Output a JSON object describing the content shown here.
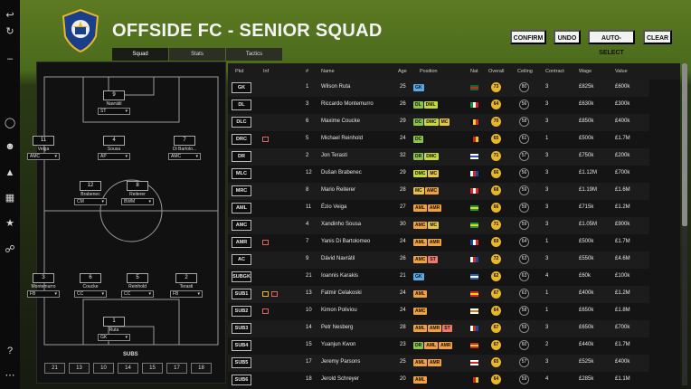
{
  "header": {
    "title": "OFFSIDE FC - SENIOR SQUAD",
    "buttons": [
      "CONFIRM",
      "UNDO",
      "AUTO-SELECT",
      "CLEAR"
    ]
  },
  "tabs": [
    "Squad",
    "Stats",
    "Tactics"
  ],
  "rail_icons": [
    "back-icon",
    "refresh-icon",
    "shield-icon",
    "users-icon",
    "tactics-icon",
    "calendar-icon",
    "trophy-icon",
    "cart-icon",
    "help-icon",
    "more-icon"
  ],
  "pitch": {
    "players": [
      {
        "num": "9",
        "name": "Navrátil",
        "role": "ST"
      },
      {
        "num": "11",
        "name": "Veiga",
        "role": "AMC"
      },
      {
        "num": "4",
        "name": "Sousa",
        "role": "AP"
      },
      {
        "num": "7",
        "name": "Di Bartolo...",
        "role": "AMC"
      },
      {
        "num": "12",
        "name": "Brabenec",
        "role": "CM"
      },
      {
        "num": "8",
        "name": "Reiterer",
        "role": "BWM"
      },
      {
        "num": "3",
        "name": "Montemurro",
        "role": "FB"
      },
      {
        "num": "6",
        "name": "Coucke",
        "role": "CC"
      },
      {
        "num": "5",
        "name": "Reinhold",
        "role": "CC"
      },
      {
        "num": "2",
        "name": "Terasti",
        "role": "FB"
      },
      {
        "num": "1",
        "name": "Ruta",
        "role": "GK"
      }
    ],
    "subs_label": "SUBS",
    "subs": [
      "21",
      "13",
      "10",
      "14",
      "15",
      "17",
      "18"
    ]
  },
  "table": {
    "headers": [
      "Pkd",
      "Inf",
      "#",
      "Name",
      "Age",
      "Position",
      "Nat",
      "Overall",
      "Ceiling",
      "Contract",
      "Wage",
      "Value"
    ],
    "rows": [
      {
        "pkd": "GK",
        "inf": "",
        "num": "1",
        "name": "Wilson Ruta",
        "age": "25",
        "pos": [
          [
            "GK",
            "gk"
          ]
        ],
        "nat": "pt",
        "ovr": "73",
        "ceil": "80",
        "contract": "3",
        "wage": "£825k",
        "value": "£600k"
      },
      {
        "pkd": "DL",
        "inf": "",
        "num": "3",
        "name": "Riccardo Montemurro",
        "age": "26",
        "pos": [
          [
            "DL",
            "def"
          ],
          [
            "DML",
            "dm"
          ]
        ],
        "nat": "it",
        "ovr": "64",
        "ceil": "56",
        "contract": "3",
        "wage": "£630k",
        "value": "£300k"
      },
      {
        "pkd": "DLC",
        "inf": "",
        "num": "6",
        "name": "Maxime Coucke",
        "age": "29",
        "pos": [
          [
            "DC",
            "def"
          ],
          [
            "DMC",
            "dm"
          ],
          [
            "MC",
            "mc"
          ]
        ],
        "nat": "be",
        "ovr": "70",
        "ceil": "58",
        "contract": "3",
        "wage": "£850k",
        "value": "£400k"
      },
      {
        "pkd": "DRC",
        "inf": "card",
        "num": "5",
        "name": "Michael Reinhold",
        "age": "24",
        "pos": [
          [
            "DC",
            "def"
          ]
        ],
        "nat": "de",
        "ovr": "65",
        "ceil": "61",
        "contract": "1",
        "wage": "£500k",
        "value": "£1.7M"
      },
      {
        "pkd": "DR",
        "inf": "",
        "num": "2",
        "name": "Jon Terasti",
        "age": "32",
        "pos": [
          [
            "DR",
            "def"
          ],
          [
            "DMC",
            "dm"
          ]
        ],
        "nat": "fi",
        "ovr": "71",
        "ceil": "57",
        "contract": "3",
        "wage": "£750k",
        "value": "£200k"
      },
      {
        "pkd": "MLC",
        "inf": "",
        "num": "12",
        "name": "Dušan Brabenec",
        "age": "29",
        "pos": [
          [
            "DMC",
            "dm"
          ],
          [
            "MC",
            "mc"
          ]
        ],
        "nat": "cz",
        "ovr": "66",
        "ceil": "56",
        "contract": "3",
        "wage": "£1.12M",
        "value": "£700k"
      },
      {
        "pkd": "MRC",
        "inf": "",
        "num": "8",
        "name": "Mario Reiterer",
        "age": "28",
        "pos": [
          [
            "MC",
            "mc"
          ],
          [
            "AMC",
            "am"
          ]
        ],
        "nat": "at",
        "ovr": "68",
        "ceil": "59",
        "contract": "3",
        "wage": "£1.19M",
        "value": "£1.6M"
      },
      {
        "pkd": "AML",
        "inf": "",
        "num": "11",
        "name": "Ézio Veiga",
        "age": "27",
        "pos": [
          [
            "AML",
            "am"
          ],
          [
            "AMR",
            "am"
          ]
        ],
        "nat": "br",
        "ovr": "66",
        "ceil": "59",
        "contract": "3",
        "wage": "£715k",
        "value": "£1.2M"
      },
      {
        "pkd": "AMC",
        "inf": "",
        "num": "4",
        "name": "Xandinho Sousa",
        "age": "30",
        "pos": [
          [
            "AMC",
            "am"
          ],
          [
            "MC",
            "mc"
          ]
        ],
        "nat": "br",
        "ovr": "71",
        "ceil": "59",
        "contract": "3",
        "wage": "£1.05M",
        "value": "£900k"
      },
      {
        "pkd": "AMR",
        "inf": "card",
        "num": "7",
        "name": "Yanis Di Bartolomeo",
        "age": "24",
        "pos": [
          [
            "AML",
            "am"
          ],
          [
            "AMR",
            "am"
          ]
        ],
        "nat": "fr",
        "ovr": "69",
        "ceil": "64",
        "contract": "1",
        "wage": "£500k",
        "value": "£1.7M"
      },
      {
        "pkd": "AC",
        "inf": "",
        "num": "9",
        "name": "Dávid Navrátil",
        "age": "26",
        "pos": [
          [
            "AMC",
            "am"
          ],
          [
            "ST",
            "st"
          ]
        ],
        "nat": "cz",
        "ovr": "72",
        "ceil": "63",
        "contract": "3",
        "wage": "£550k",
        "value": "£4.6M"
      },
      {
        "pkd": "SUBGK",
        "inf": "",
        "num": "21",
        "name": "Ioannis Karakis",
        "age": "21",
        "pos": [
          [
            "GK",
            "gk"
          ]
        ],
        "nat": "gr",
        "ovr": "62",
        "ceil": "63",
        "contract": "4",
        "wage": "£60k",
        "value": "£100k"
      },
      {
        "pkd": "SUB1",
        "inf": "card2",
        "num": "13",
        "name": "Fatmir Celakoski",
        "age": "24",
        "pos": [
          [
            "AML",
            "am"
          ]
        ],
        "nat": "mk",
        "ovr": "67",
        "ceil": "63",
        "contract": "1",
        "wage": "£400k",
        "value": "£1.2M"
      },
      {
        "pkd": "SUB2",
        "inf": "card",
        "num": "10",
        "name": "Kimon Poliviou",
        "age": "24",
        "pos": [
          [
            "AMC",
            "am"
          ]
        ],
        "nat": "cy",
        "ovr": "64",
        "ceil": "58",
        "contract": "1",
        "wage": "£650k",
        "value": "£1.8M"
      },
      {
        "pkd": "SUB3",
        "inf": "",
        "num": "14",
        "name": "Petr Nesberg",
        "age": "28",
        "pos": [
          [
            "AML",
            "am"
          ],
          [
            "AMR",
            "am"
          ],
          [
            "ST",
            "st"
          ]
        ],
        "nat": "cz",
        "ovr": "67",
        "ceil": "59",
        "contract": "3",
        "wage": "£650k",
        "value": "£700k"
      },
      {
        "pkd": "SUB4",
        "inf": "",
        "num": "15",
        "name": "Yuanjun Kwon",
        "age": "23",
        "pos": [
          [
            "DR",
            "def"
          ],
          [
            "AML",
            "am"
          ],
          [
            "AMR",
            "am"
          ]
        ],
        "nat": "cn",
        "ovr": "67",
        "ceil": "60",
        "contract": "2",
        "wage": "£440k",
        "value": "£1.7M"
      },
      {
        "pkd": "SUB5",
        "inf": "",
        "num": "17",
        "name": "Jeremy Parsons",
        "age": "25",
        "pos": [
          [
            "AML",
            "am"
          ],
          [
            "AMR",
            "am"
          ]
        ],
        "nat": "en",
        "ovr": "65",
        "ceil": "57",
        "contract": "3",
        "wage": "£525k",
        "value": "£400k"
      },
      {
        "pkd": "SUB6",
        "inf": "",
        "num": "18",
        "name": "Jerold Schreyer",
        "age": "20",
        "pos": [
          [
            "AML",
            "am"
          ]
        ],
        "nat": "de",
        "ovr": "64",
        "ceil": "59",
        "contract": "4",
        "wage": "£285k",
        "value": "£1.1M"
      }
    ]
  },
  "colors": {
    "accent_gold": "#e8b62b",
    "pitch_line": "#9a9a9a"
  }
}
